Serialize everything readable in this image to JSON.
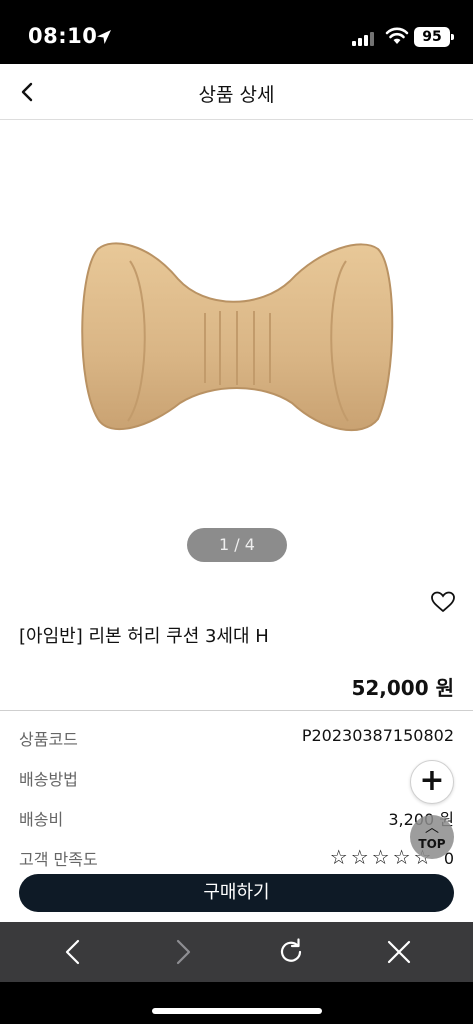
{
  "status_bar": {
    "time": "08:10",
    "battery": "95"
  },
  "header": {
    "title": "상품 상세",
    "back_icon": "chevron-left-icon"
  },
  "product": {
    "image_pager": "1 / 4",
    "name": "[아임반] 리본 허리 쿠션 3세대 H",
    "price": "52,000 원",
    "image_color": "#dcb88a"
  },
  "info": [
    {
      "label": "상품코드",
      "value": "P20230387150802"
    },
    {
      "label": "배송방법",
      "value": ""
    },
    {
      "label": "배송비",
      "value": "3,200 원"
    },
    {
      "label": "고객 만족도",
      "value": "0",
      "stars": "☆☆☆☆☆"
    }
  ],
  "floating": {
    "plus": "+",
    "top_label": "TOP"
  },
  "buy_button": {
    "label": "구매하기",
    "color": "#0e1a26"
  },
  "browser": {
    "icons": [
      "back-arrow-icon",
      "forward-arrow-icon",
      "reload-icon",
      "close-icon"
    ]
  }
}
